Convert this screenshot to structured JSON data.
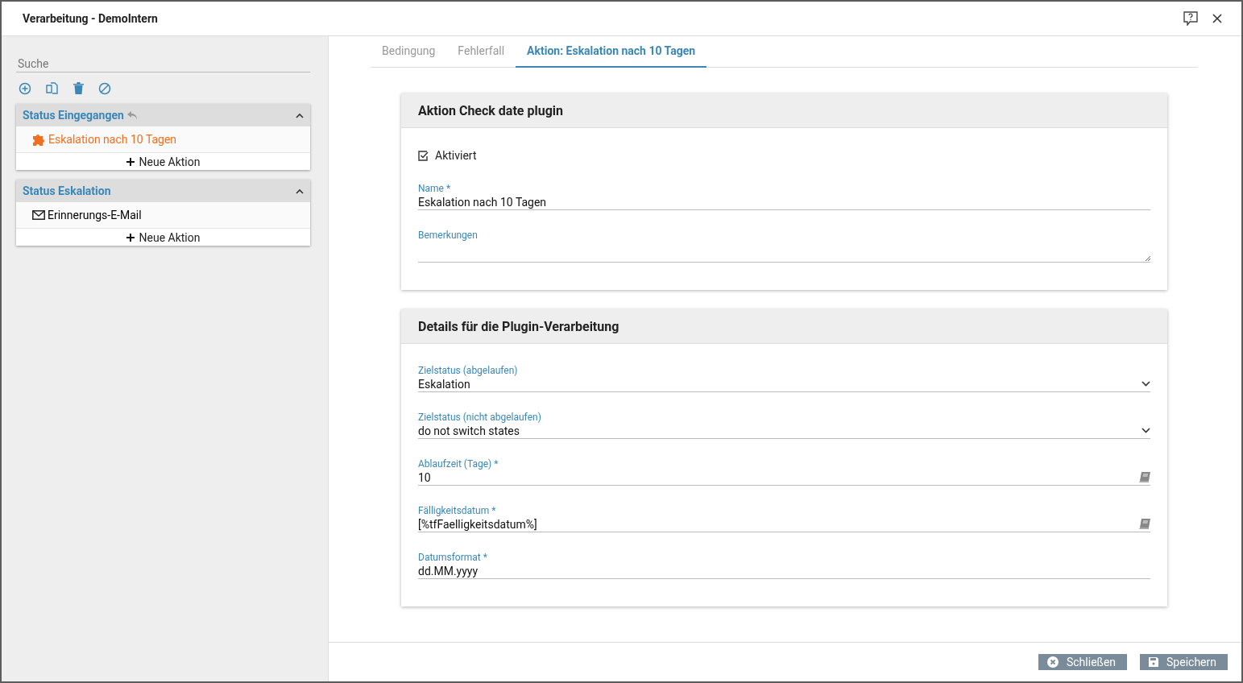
{
  "window": {
    "title": "Verarbeitung - DemoIntern"
  },
  "sidebar": {
    "search": {
      "placeholder": "Suche"
    },
    "groups": [
      {
        "title": "Status Eingegangen",
        "back_icon": true,
        "expanded": true,
        "actions": [
          {
            "label": "Eskalation nach 10 Tagen",
            "kind": "plugin",
            "selected": true
          }
        ],
        "add_label": "Neue Aktion"
      },
      {
        "title": "Status Eskalation",
        "back_icon": false,
        "expanded": true,
        "actions": [
          {
            "label": "Erinnerungs-E-Mail",
            "kind": "mail",
            "selected": false
          }
        ],
        "add_label": "Neue Aktion"
      }
    ]
  },
  "tabs": [
    {
      "label": "Bedingung",
      "selected": false
    },
    {
      "label": "Fehlerfall",
      "selected": false
    },
    {
      "label": "Aktion: Eskalation nach 10 Tagen",
      "selected": true
    }
  ],
  "sections": [
    {
      "title": "Aktion Check date plugin",
      "fields": [
        {
          "kind": "checkbox",
          "label": "Aktiviert",
          "checked": true
        },
        {
          "kind": "text",
          "label": "Name *",
          "value": "Eskalation nach 10 Tagen"
        },
        {
          "kind": "textarea",
          "label": "Bemerkungen"
        }
      ]
    },
    {
      "title": "Details für die Plugin-Verarbeitung",
      "fields": [
        {
          "kind": "select",
          "label": "Zielstatus (abgelaufen)",
          "value": "Eskalation"
        },
        {
          "kind": "select",
          "label": "Zielstatus (nicht abgelaufen)",
          "value": "do not switch states"
        },
        {
          "kind": "lookup",
          "label": "Ablaufzeit (Tage) *",
          "value": "10"
        },
        {
          "kind": "lookup",
          "label": "Fälligkeitsdatum *",
          "value": "[%tfFaelligkeitsdatum%]"
        },
        {
          "kind": "text",
          "label": "Datumsformat *",
          "value": "dd.MM.yyyy"
        }
      ]
    }
  ],
  "footer": {
    "buttons": [
      {
        "label": "Schließen",
        "kind": "close"
      },
      {
        "label": "Speichern",
        "kind": "save"
      }
    ]
  }
}
